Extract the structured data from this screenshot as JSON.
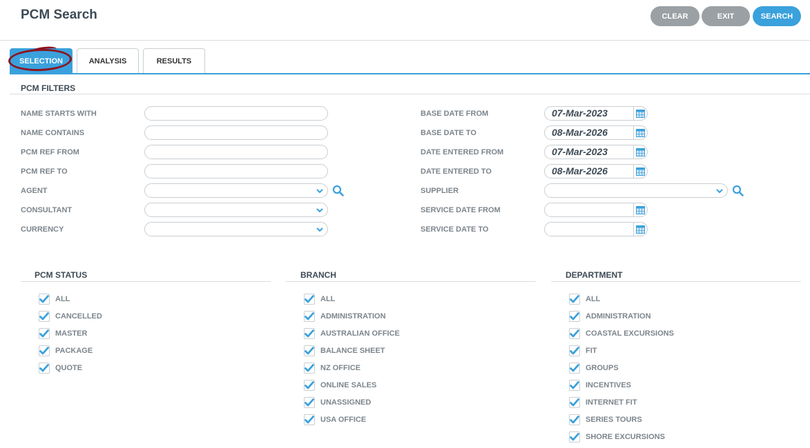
{
  "header": {
    "title": "PCM Search",
    "buttons": {
      "clear": "CLEAR",
      "exit": "EXIT",
      "search": "SEARCH"
    }
  },
  "tabs": [
    "SELECTION",
    "ANALYSIS",
    "RESULTS"
  ],
  "active_tab": "SELECTION",
  "filters": {
    "section_title": "PCM FILTERS",
    "left": [
      {
        "label": "NAME STARTS WITH",
        "type": "text",
        "value": ""
      },
      {
        "label": "NAME CONTAINS",
        "type": "text",
        "value": ""
      },
      {
        "label": "PCM REF FROM",
        "type": "text",
        "value": ""
      },
      {
        "label": "PCM REF TO",
        "type": "text",
        "value": ""
      },
      {
        "label": "AGENT",
        "type": "select",
        "value": ""
      },
      {
        "label": "CONSULTANT",
        "type": "select",
        "value": ""
      },
      {
        "label": "CURRENCY",
        "type": "select",
        "value": ""
      }
    ],
    "right": [
      {
        "label": "BASE DATE FROM",
        "type": "date",
        "value": "07-Mar-2023"
      },
      {
        "label": "BASE DATE TO",
        "type": "date",
        "value": "08-Mar-2026"
      },
      {
        "label": "DATE ENTERED FROM",
        "type": "date",
        "value": "07-Mar-2023"
      },
      {
        "label": "DATE ENTERED TO",
        "type": "date",
        "value": "08-Mar-2026"
      },
      {
        "label": "SUPPLIER",
        "type": "select",
        "value": ""
      },
      {
        "label": "SERVICE DATE FROM",
        "type": "date",
        "value": ""
      },
      {
        "label": "SERVICE DATE TO",
        "type": "date",
        "value": ""
      }
    ]
  },
  "pcm_status": {
    "title": "PCM STATUS",
    "items": [
      {
        "label": "ALL",
        "checked": true
      },
      {
        "label": "CANCELLED",
        "checked": true
      },
      {
        "label": "MASTER",
        "checked": true
      },
      {
        "label": "PACKAGE",
        "checked": true
      },
      {
        "label": "QUOTE",
        "checked": true
      }
    ]
  },
  "branch": {
    "title": "BRANCH",
    "items": [
      {
        "label": "ALL",
        "checked": true
      },
      {
        "label": "ADMINISTRATION",
        "checked": true
      },
      {
        "label": "AUSTRALIAN OFFICE",
        "checked": true
      },
      {
        "label": "BALANCE SHEET",
        "checked": true
      },
      {
        "label": "NZ OFFICE",
        "checked": true
      },
      {
        "label": "ONLINE SALES",
        "checked": true
      },
      {
        "label": "UNASSIGNED",
        "checked": true
      },
      {
        "label": "USA OFFICE",
        "checked": true
      }
    ]
  },
  "department": {
    "title": "DEPARTMENT",
    "items": [
      {
        "label": "ALL",
        "checked": true
      },
      {
        "label": "ADMINISTRATION",
        "checked": true
      },
      {
        "label": "COASTAL EXCURSIONS",
        "checked": true
      },
      {
        "label": "FIT",
        "checked": true
      },
      {
        "label": "GROUPS",
        "checked": true
      },
      {
        "label": "INCENTIVES",
        "checked": true
      },
      {
        "label": "INTERNET FIT",
        "checked": true
      },
      {
        "label": "SERIES TOURS",
        "checked": true
      },
      {
        "label": "SHORE EXCURSIONS",
        "checked": true
      }
    ]
  },
  "colors": {
    "accent": "#3aa1dc",
    "button_grey": "#9aa0a4",
    "annotation": "#8b1420"
  },
  "icons": {
    "search": "search-icon",
    "calendar": "calendar-icon",
    "dropdown": "chevron-down-icon",
    "check": "checkmark-icon"
  }
}
